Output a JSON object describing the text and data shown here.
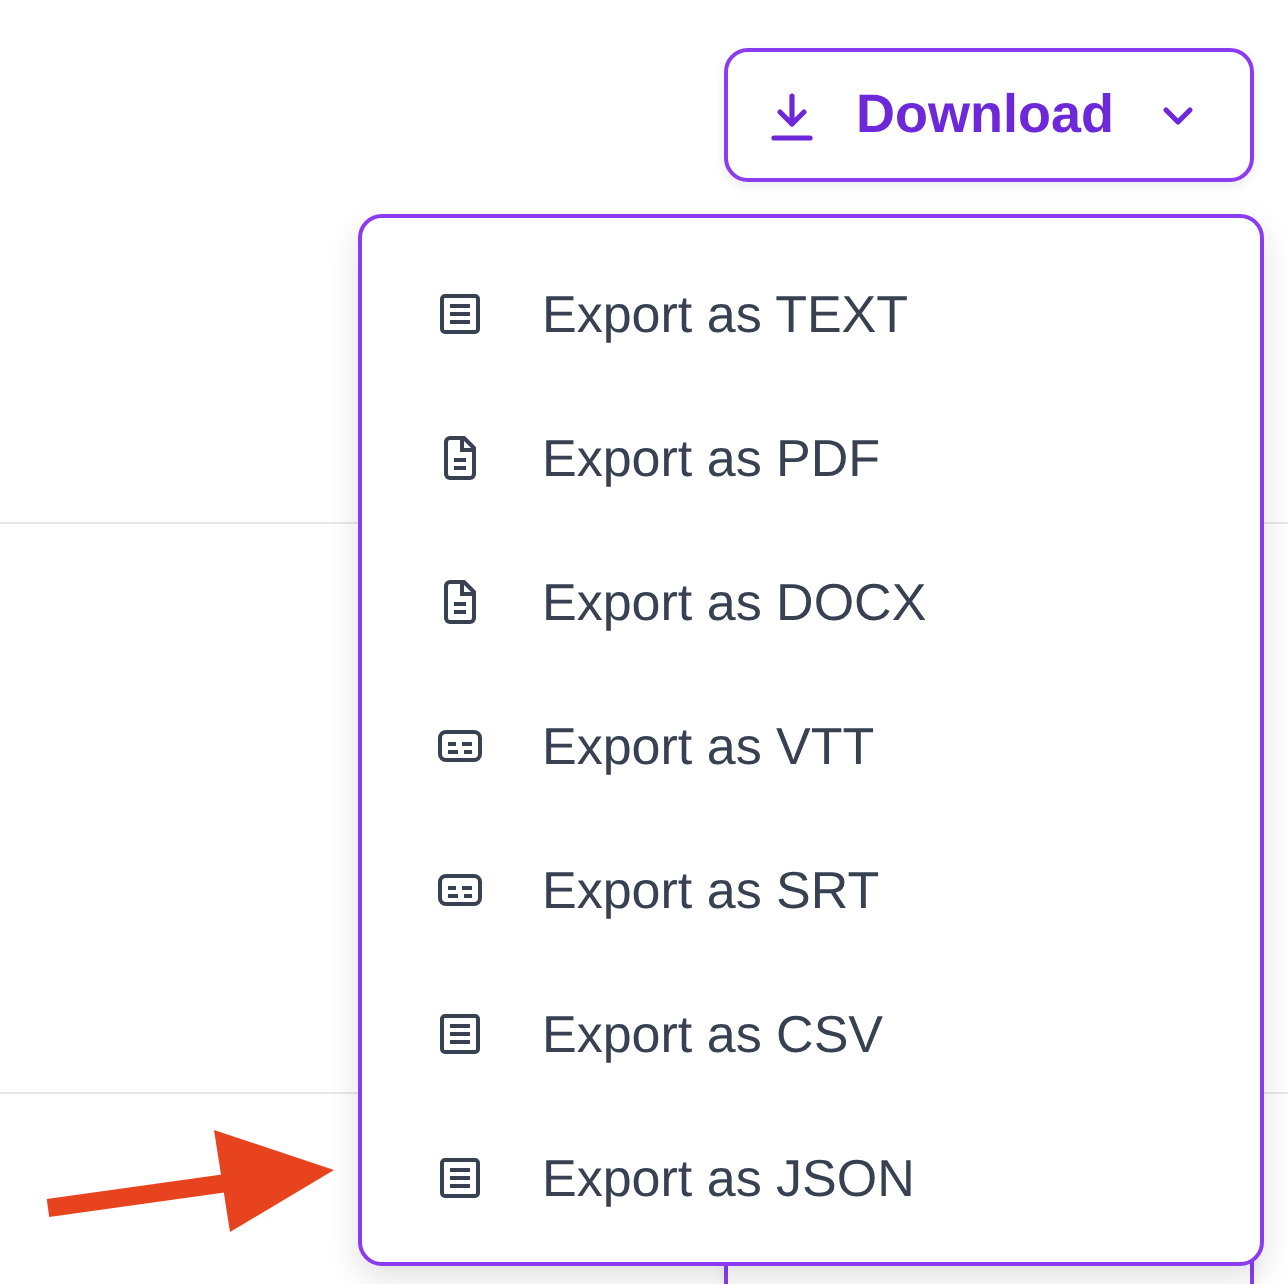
{
  "download_buttons": [
    {
      "label": "Download"
    }
  ],
  "menu": {
    "items": [
      {
        "label": "Export as TEXT",
        "kind": "lines"
      },
      {
        "label": "Export as PDF",
        "kind": "document"
      },
      {
        "label": "Export as DOCX",
        "kind": "document"
      },
      {
        "label": "Export as VTT",
        "kind": "captions"
      },
      {
        "label": "Export as SRT",
        "kind": "captions"
      },
      {
        "label": "Export as CSV",
        "kind": "lines"
      },
      {
        "label": "Export as JSON",
        "kind": "lines"
      }
    ]
  }
}
